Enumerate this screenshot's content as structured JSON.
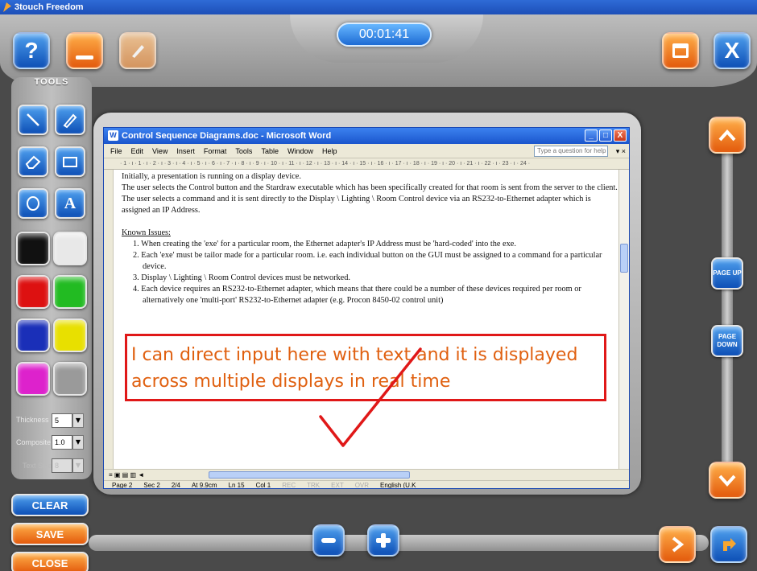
{
  "app": {
    "title": "3touch Freedom"
  },
  "timer": {
    "value": "00:01:41"
  },
  "top_buttons": {
    "help_label": "?",
    "minimize_label": "",
    "close_label": "X"
  },
  "tools": {
    "title": "TOOLS",
    "text_tool_label": "A",
    "colors": [
      "#111111",
      "#e8e8e8",
      "#dd1111",
      "#22bb22",
      "#1a2fb8",
      "#e8e000",
      "#dd22cc",
      "#9a9a9a"
    ],
    "thickness_label": "Thickness",
    "thickness_value": "5",
    "composite_label": "Composite",
    "composite_value": "1.0",
    "textsize_label": "Text Size",
    "textsize_value": "8"
  },
  "actions": {
    "clear": "CLEAR",
    "save": "SAVE",
    "close": "CLOSE"
  },
  "nav": {
    "page_up": "PAGE UP",
    "page_down": "PAGE DOWN"
  },
  "word": {
    "window_title": "Control Sequence Diagrams.doc - Microsoft Word",
    "menu": [
      "File",
      "Edit",
      "View",
      "Insert",
      "Format",
      "Tools",
      "Table",
      "Window",
      "Help"
    ],
    "help_placeholder": "Type a question for help",
    "ruler": "· 1 · ı · 1 · ı · 2 · ı · 3 · ı · 4 · ı · 5 · ı · 6 · ı · 7 · ı · 8 · ı · 9 · ı · 10 · ı · 11 · ı · 12 · ı · 13 · ı · 14 · ı · 15 · ı · 16 · ı · 17 · ı · 18 · ı · 19 · ı · 20 · ı · 21 · ı · 22 · ı · 23 · ı · 24 ·",
    "paragraphs": {
      "p1": "Initially, a presentation is running on a display device.",
      "p2": "The user selects the Control button and the Stardraw executable which has been specifically created for that room is sent from the server to the client.",
      "p3": "The user selects a command and it is sent directly to the Display \\ Lighting \\ Room Control device via an RS232-to-Ethernet adapter which is assigned an IP Address.",
      "known_issues": "Known Issues:",
      "i1": "1.  When creating the 'exe' for a particular room, the Ethernet adapter's IP Address must be 'hard-coded' into the exe.",
      "i2": "2.  Each 'exe' must be tailor made for a particular room. i.e. each individual button on the GUI must be assigned to a command for a particular device.",
      "i3": "3.  Display \\ Lighting \\ Room Control devices must be networked.",
      "i4": "4.  Each device requires an RS232-to-Ethernet adapter, which means that there could be a number of these devices required per room or alternatively one 'multi-port' RS232-to-Ethernet adapter (e.g. Procon 8450-02 control unit)"
    },
    "status": {
      "page": "Page 2",
      "sec": "Sec 2",
      "pages": "2/4",
      "at": "At 9.9cm",
      "ln": "Ln 15",
      "col": "Col 1",
      "rec": "REC",
      "trk": "TRK",
      "ext": "EXT",
      "ovr": "OVR",
      "lang": "English (U.K"
    }
  },
  "annotation": {
    "text": "I can direct input here with text and it is displayed across multiple displays in real time"
  }
}
